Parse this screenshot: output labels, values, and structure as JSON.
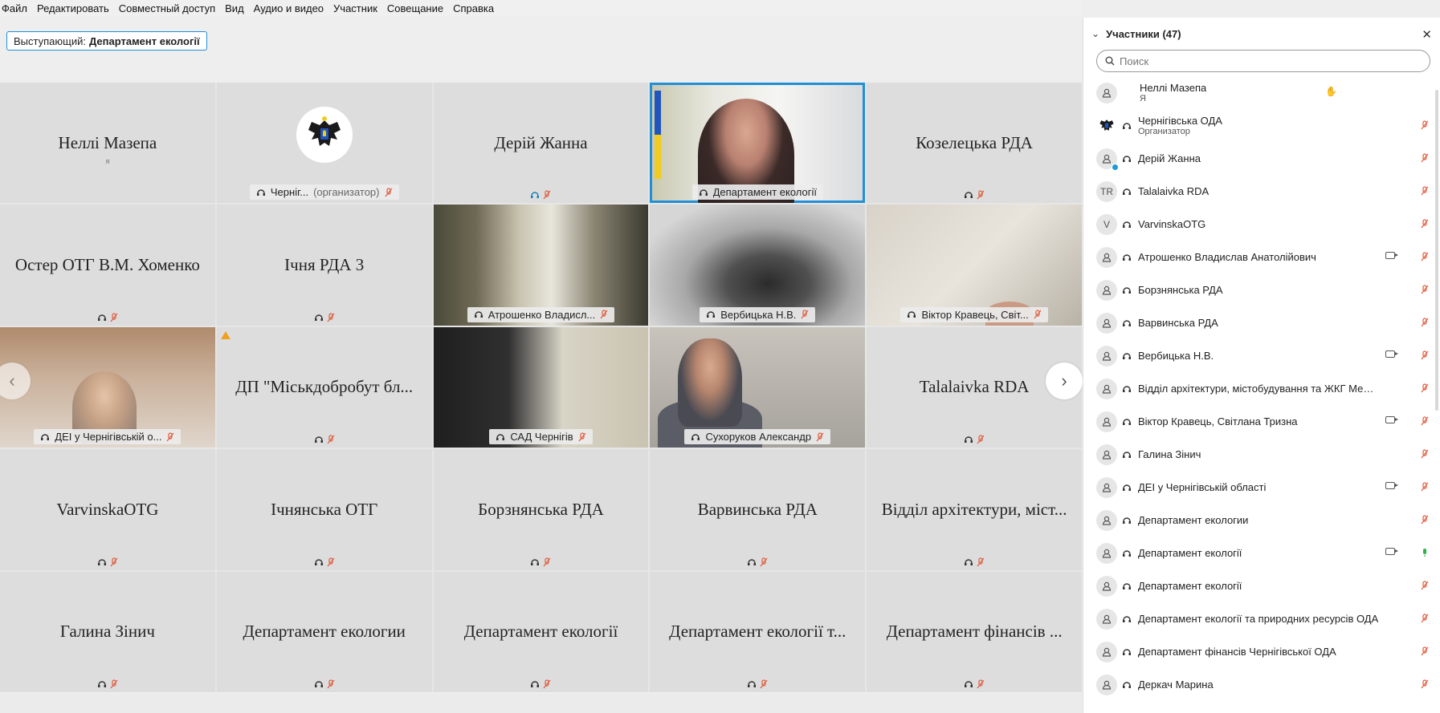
{
  "menu": [
    "Файл",
    "Редактировать",
    "Совместный доступ",
    "Вид",
    "Аудио и видео",
    "Участник",
    "Совещание",
    "Справка"
  ],
  "speaker": {
    "prefix": "Выступающий:",
    "name": "Департамент екології"
  },
  "grid": {
    "tiles": [
      {
        "name": "Неллі Мазепа",
        "sub": "я"
      },
      {
        "label": "Черніг...",
        "label_extra": "(организатор)"
      },
      {
        "name": "Дерій Жанна"
      },
      {
        "label": "Департамент екології"
      },
      {
        "name": "Козелецька РДА"
      },
      {
        "name": "Остер ОТГ В.М. Хоменко"
      },
      {
        "name": "Ічня РДА 3"
      },
      {
        "label": "Атрошенко Владисл..."
      },
      {
        "label": "Вербицька Н.В."
      },
      {
        "label": "Віктор Кравець, Світ..."
      },
      {
        "label": "ДЕІ у Чернігівській о..."
      },
      {
        "name": "ДП \"Міськдобробут бл..."
      },
      {
        "label": "САД Чернігів"
      },
      {
        "label": "Сухоруков Александр"
      },
      {
        "name": "Talalaivka RDA"
      },
      {
        "name": "VarvinskaOTG"
      },
      {
        "name": "Ічнянська ОТГ"
      },
      {
        "name": "Борзнянська РДА"
      },
      {
        "name": "Варвинська РДА"
      },
      {
        "name": "Відділ архітектури, міст..."
      },
      {
        "name": "Галина Зінич"
      },
      {
        "name": "Департамент екологии"
      },
      {
        "name": "Департамент екології"
      },
      {
        "name": "Департамент екології т..."
      },
      {
        "name": "Департамент фінансів ..."
      }
    ]
  },
  "panel": {
    "title": "Участники (47)",
    "search_placeholder": "Поиск",
    "participants": [
      {
        "name": "Неллі Мазепа",
        "role": "Я"
      },
      {
        "name": "Чернігівська ОДА",
        "role": "Организатор"
      },
      {
        "name": "Дерій Жанна"
      },
      {
        "initials": "TR",
        "name": "Talalaivka RDA"
      },
      {
        "initials": "V",
        "name": "VarvinskaOTG"
      },
      {
        "name": "Атрошенко Владислав Анатолійович"
      },
      {
        "name": "Борзнянська РДА"
      },
      {
        "name": "Варвинська РДА"
      },
      {
        "name": "Вербицька Н.В."
      },
      {
        "name": "Відділ архітектури, містобудування та ЖКГ Менс..."
      },
      {
        "name": "Віктор Кравець, Світлана Тризна"
      },
      {
        "name": "Галина Зінич"
      },
      {
        "name": "ДЕІ у Чернігівській області"
      },
      {
        "name": "Департамент екологии"
      },
      {
        "name": "Департамент екології"
      },
      {
        "name": "Департамент екології"
      },
      {
        "name": "Департамент екології та природних ресурсів ОДА"
      },
      {
        "name": "Департамент фінансів Чернігівської ОДА"
      },
      {
        "name": "Деркач Марина"
      }
    ]
  },
  "colors": {
    "accent": "#1f8fd6",
    "mic_off": "#e05a3a",
    "mic_on": "#2db34a"
  }
}
